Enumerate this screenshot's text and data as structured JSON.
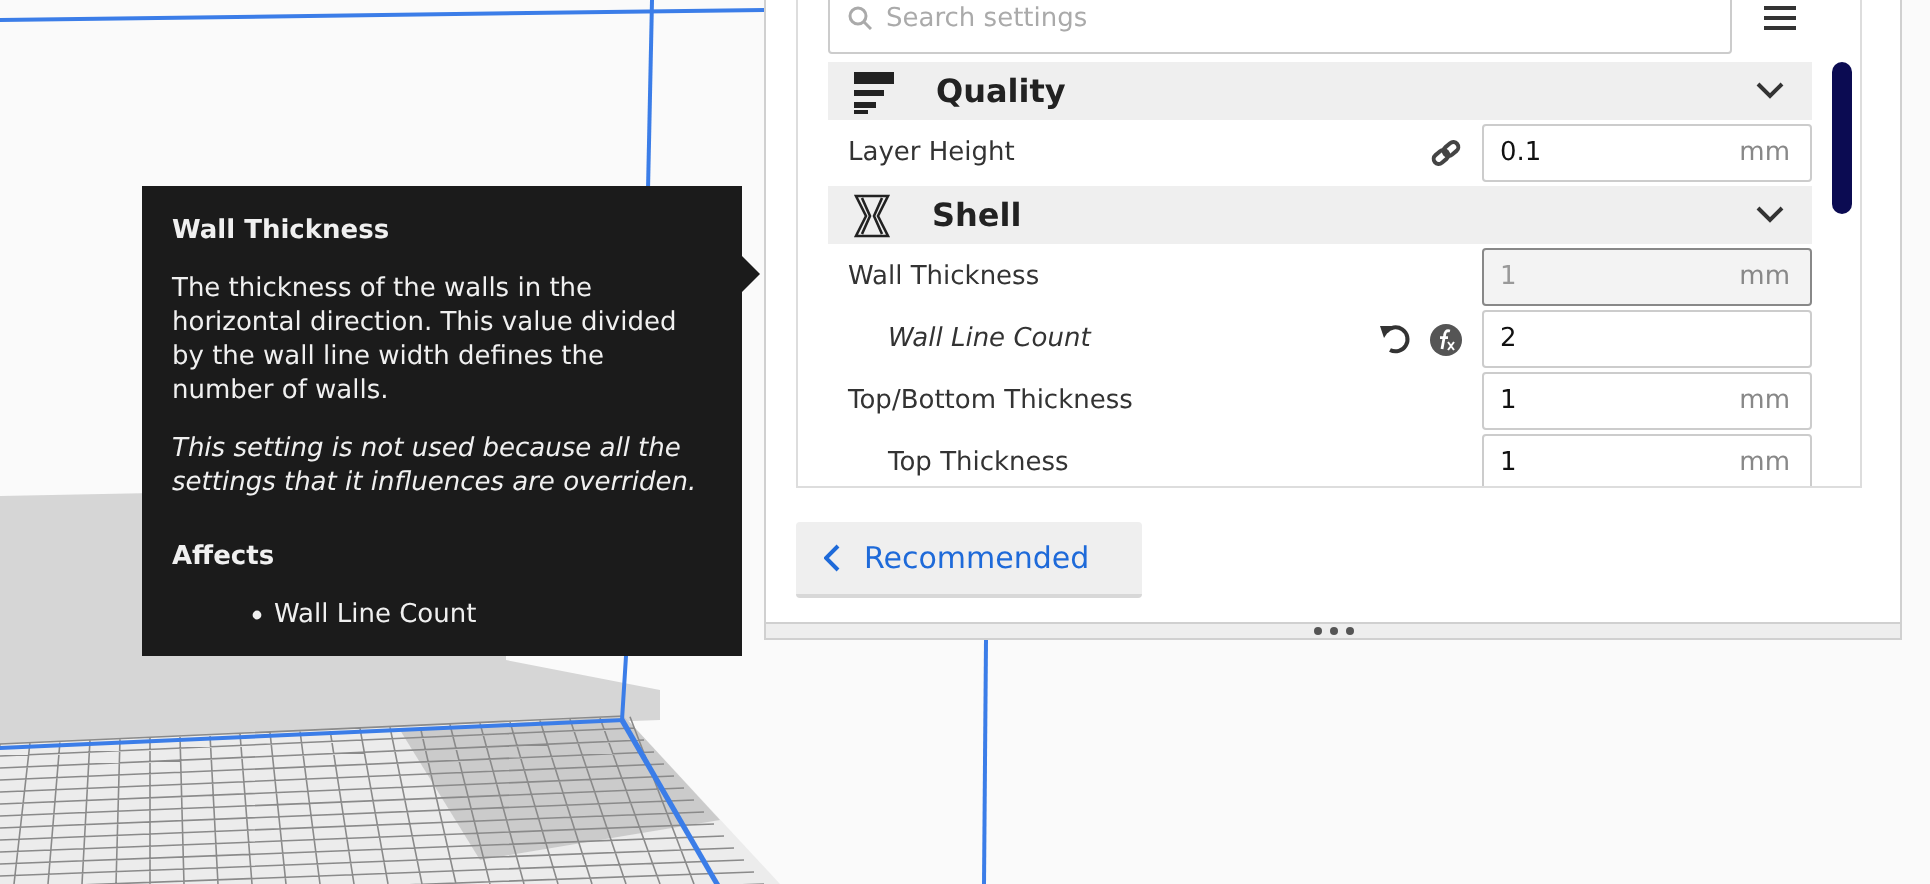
{
  "tooltip": {
    "title": "Wall Thickness",
    "description": "The thickness of the walls in the horizontal direction. This value divided by the wall line width defines the number of walls.",
    "note": "This setting is not used because all the settings that it influences are overriden.",
    "affects_heading": "Affects",
    "affects": [
      "Wall Line Count"
    ]
  },
  "settings_panel": {
    "search": {
      "placeholder": "Search settings"
    },
    "sections": [
      {
        "title": "Quality",
        "kind": "quality",
        "expanded": true,
        "settings": [
          {
            "label": "Layer Height",
            "value": "0.1",
            "unit": "mm",
            "disabled": false,
            "overridden": false,
            "linked": true,
            "resettable": false,
            "from_formula": false
          }
        ]
      },
      {
        "title": "Shell",
        "kind": "shell",
        "expanded": true,
        "settings": [
          {
            "label": "Wall Thickness",
            "value": "1",
            "unit": "mm",
            "disabled": true,
            "overridden": false,
            "linked": false,
            "resettable": false,
            "from_formula": false,
            "children": [
              {
                "label": "Wall Line Count",
                "value": "2",
                "disabled": false,
                "overridden": true,
                "linked": false,
                "resettable": true,
                "from_formula": true
              }
            ]
          },
          {
            "label": "Top/Bottom Thickness",
            "value": "1",
            "unit": "mm",
            "disabled": false,
            "overridden": false,
            "linked": false,
            "resettable": false,
            "from_formula": false,
            "children": [
              {
                "label": "Top Thickness",
                "value": "1",
                "unit": "mm",
                "disabled": false,
                "overridden": false,
                "linked": false,
                "resettable": false,
                "from_formula": false
              }
            ]
          }
        ]
      }
    ],
    "footer_button": "Recommended"
  }
}
